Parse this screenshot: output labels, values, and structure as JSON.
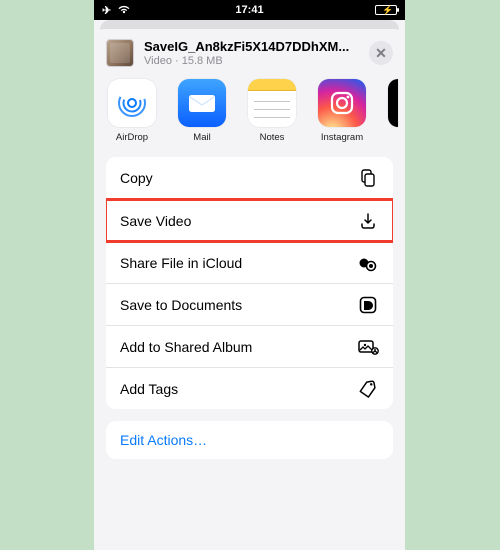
{
  "statusbar": {
    "time": "17:41",
    "airplane_glyph": "✈",
    "wifi_glyph": "⧛"
  },
  "header": {
    "title": "SaveIG_An8kzFi5X14D7DDhXM...",
    "subtitle": "Video · 15.8 MB"
  },
  "share_targets": [
    {
      "key": "airdrop",
      "label": "AirDrop"
    },
    {
      "key": "mail",
      "label": "Mail"
    },
    {
      "key": "notes",
      "label": "Notes"
    },
    {
      "key": "instagram",
      "label": "Instagram"
    }
  ],
  "actions": {
    "copy": "Copy",
    "save_video": "Save Video",
    "share_icloud": "Share File in iCloud",
    "save_documents": "Save to Documents",
    "add_shared_album": "Add to Shared Album",
    "add_tags": "Add Tags"
  },
  "edit_actions": "Edit Actions…",
  "highlighted_action": "save_video"
}
